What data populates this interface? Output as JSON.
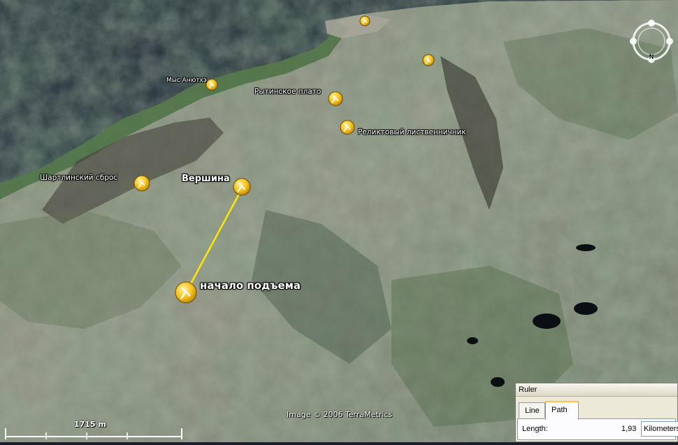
{
  "map": {
    "credit": "Image © 2006 TerraMetrics",
    "scale_label": "1715 m",
    "compass_letter": "N",
    "placemarks": [
      {
        "id": "mys",
        "label": "Мыс Анютхэ"
      },
      {
        "id": "rytin",
        "label": "Рытинское плато"
      },
      {
        "id": "relikt",
        "label": "Реликтовый лиственничник"
      },
      {
        "id": "shartl",
        "label": "Шартлинский сброс"
      },
      {
        "id": "vershina",
        "label": "Вершина"
      },
      {
        "id": "nachalo",
        "label": "начало подъема"
      }
    ]
  },
  "ruler": {
    "title": "Ruler",
    "tabs": [
      "Line",
      "Path"
    ],
    "active_tab": "Path",
    "length_label": "Length:",
    "length_value": "1,93",
    "unit": "Kilometers"
  },
  "colors": {
    "path_line": "#ffe600",
    "pin_yellow": "#f7c21b",
    "water": "#0f1930"
  }
}
